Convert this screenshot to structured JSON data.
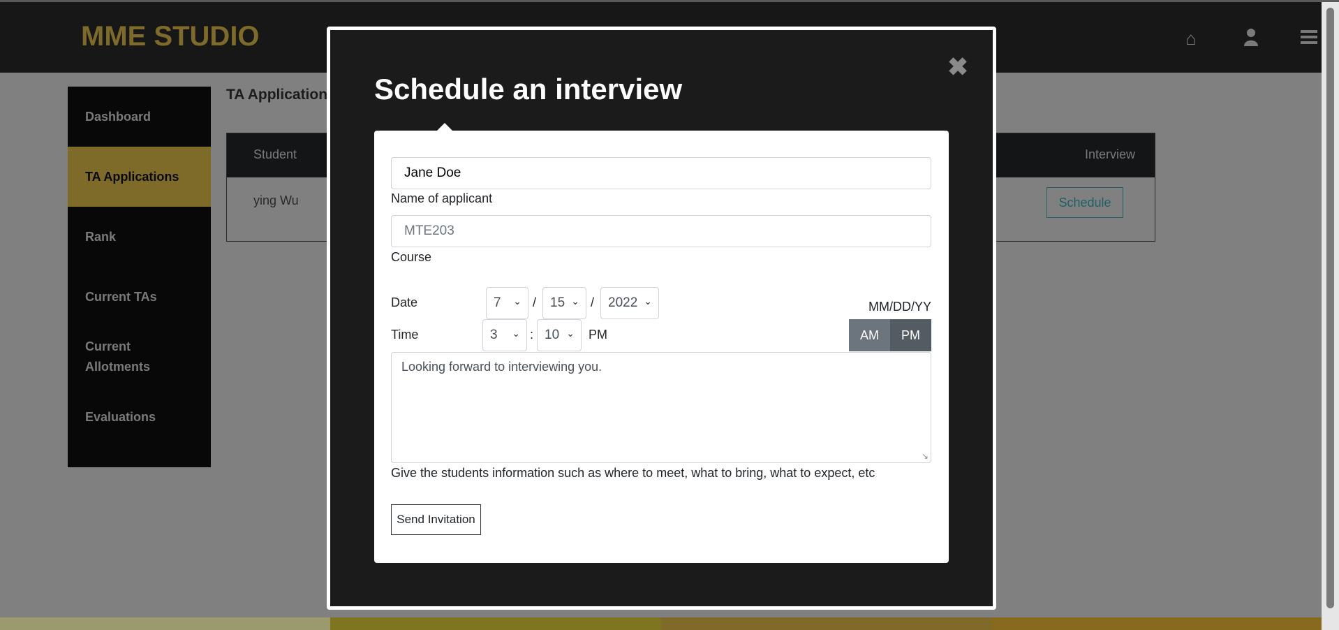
{
  "app": {
    "logo": "MME STUDIO",
    "nav_icons": [
      "home-icon",
      "user-icon",
      "menu-icon"
    ]
  },
  "sidebar": {
    "items": [
      {
        "label": "Dashboard"
      },
      {
        "label": "TA Applications",
        "active": true
      },
      {
        "label": "Rank"
      },
      {
        "label": "Current TAs"
      },
      {
        "label": "Current Allotments"
      },
      {
        "label": "Evaluations"
      }
    ]
  },
  "main": {
    "heading": "TA Applications",
    "table": {
      "headers": [
        "Student",
        "Interview"
      ],
      "rows": [
        {
          "student": "ying Wu",
          "action": "Schedule"
        }
      ]
    }
  },
  "modal": {
    "title": "Schedule an interview",
    "close_icon": "close-icon",
    "name_value": "Jane Doe",
    "name_label": "Name of applicant",
    "course_placeholder": "MTE203",
    "course_label": "Course",
    "date_label": "Date",
    "month": "7",
    "day": "15",
    "year": "2022",
    "date_sep": "/",
    "date_format": "MM/DD/YY",
    "time_label": "Time",
    "hour": "3",
    "minute": "10",
    "time_sep": ":",
    "meridiem": "PM",
    "am_label": "AM",
    "pm_label": "PM",
    "message": "Looking forward to interviewing you.",
    "message_help": "Give the students information such as where to meet, what to bring, what to expect, etc",
    "send_label": "Send Invitation"
  },
  "colors": {
    "brand_gold": "#7f6b29",
    "topbar": "#171717",
    "modal_bg": "#1b1b1b",
    "accent_teal": "#1f5f66"
  }
}
